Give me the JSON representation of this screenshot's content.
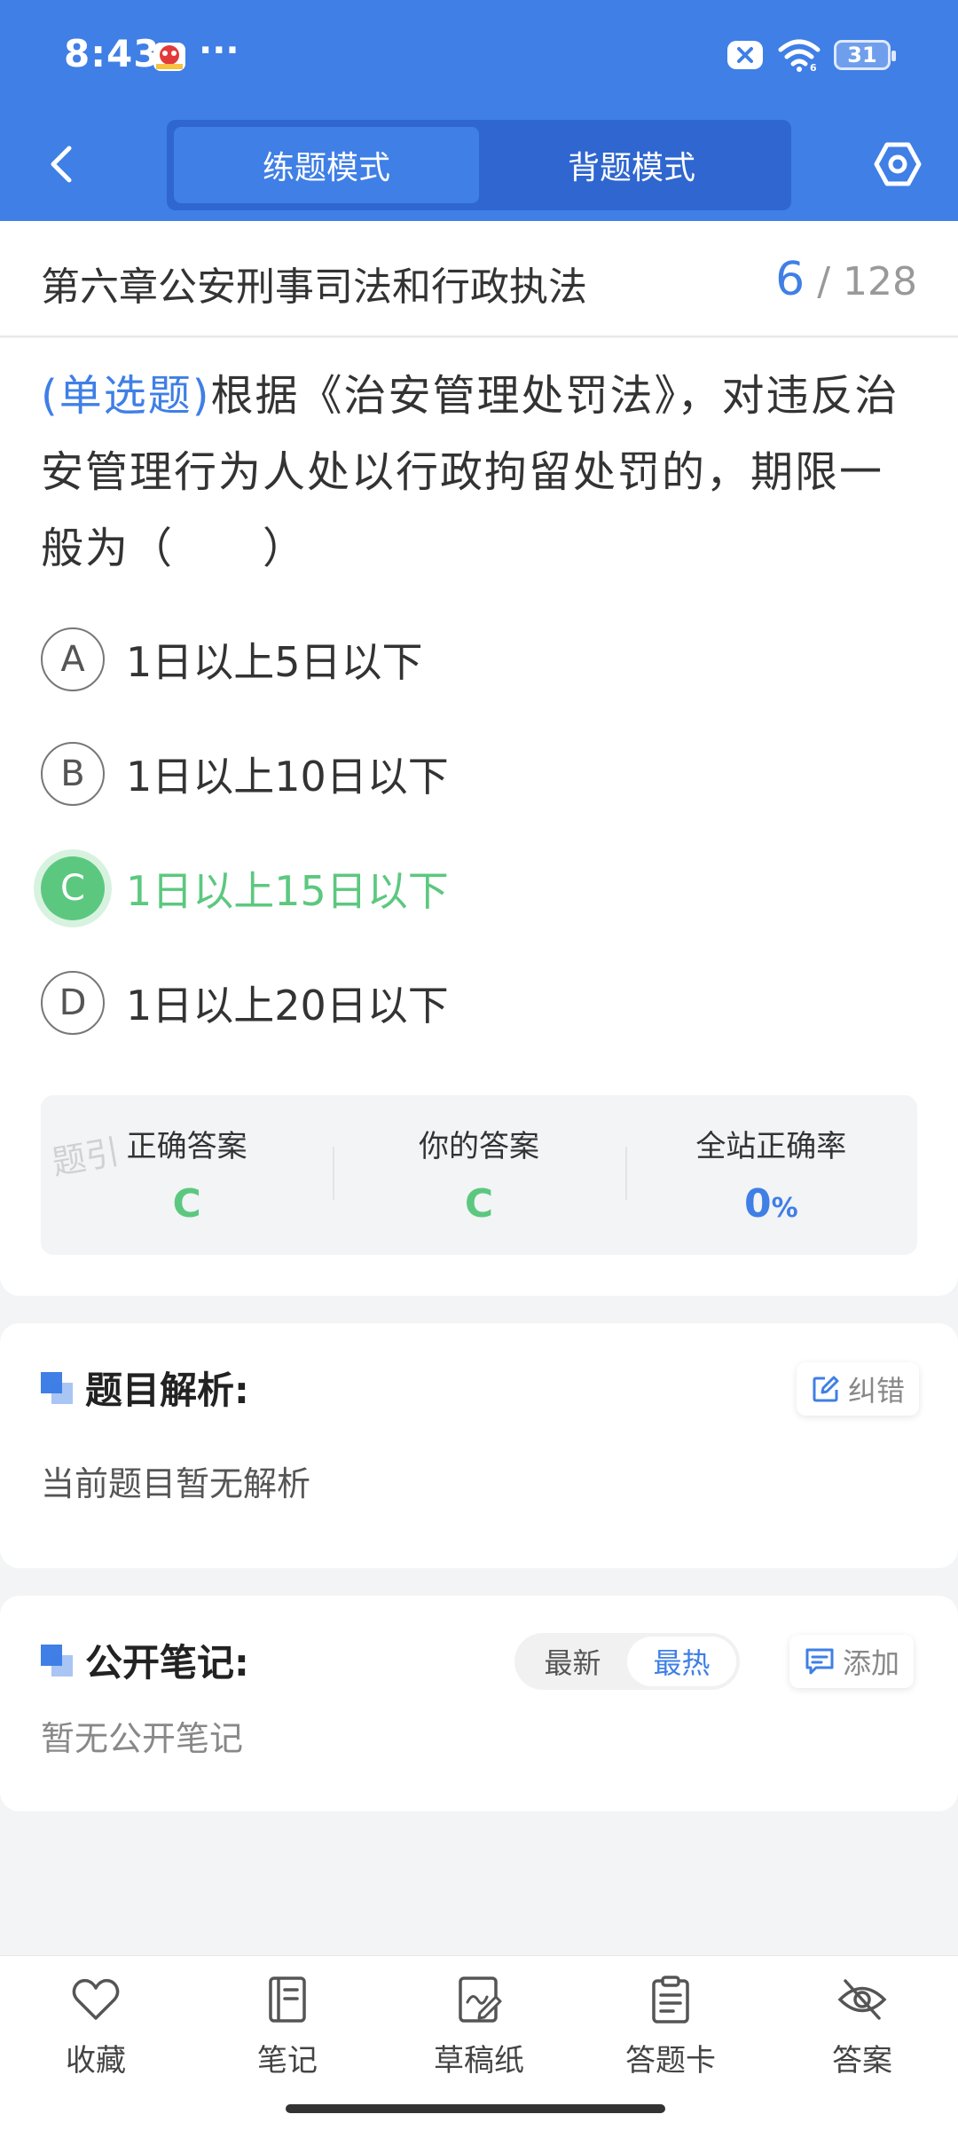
{
  "status_bar": {
    "time": "8:43",
    "dots": "···",
    "battery": "31"
  },
  "nav": {
    "tabs": [
      {
        "label": "练题模式",
        "active": true
      },
      {
        "label": "背题模式",
        "active": false
      }
    ]
  },
  "chapter": {
    "title": "第六章公安刑事司法和行政执法",
    "current": "6",
    "separator": "/",
    "total": "128"
  },
  "question": {
    "type_label": "(单选题)",
    "text": "根据《治安管理处罚法》，对违反治安管理行为人处以行政拘留处罚的，期限一般为（　　）",
    "options": [
      {
        "letter": "A",
        "text": "1日以上5日以下"
      },
      {
        "letter": "B",
        "text": "1日以上10日以下"
      },
      {
        "letter": "C",
        "text": "1日以上15日以下"
      },
      {
        "letter": "D",
        "text": "1日以上20日以下"
      }
    ],
    "selected": "C"
  },
  "answer_summary": {
    "correct_label": "正确答案",
    "correct_value": "C",
    "yours_label": "你的答案",
    "yours_value": "C",
    "rate_label": "全站正确率",
    "rate_value": "0",
    "rate_unit": "%",
    "watermark": "题引"
  },
  "analysis": {
    "title": "题目解析:",
    "report_button": "纠错",
    "text": "当前题目暂无解析"
  },
  "notes": {
    "title": "公开笔记:",
    "sort_newest": "最新",
    "sort_hottest": "最热",
    "add_button": "添加",
    "empty_text": "暂无公开笔记"
  },
  "bottom_bar": {
    "items": [
      {
        "label": "收藏",
        "icon": "heart-icon"
      },
      {
        "label": "笔记",
        "icon": "notebook-icon"
      },
      {
        "label": "草稿纸",
        "icon": "draft-paper-icon"
      },
      {
        "label": "答题卡",
        "icon": "answer-card-icon"
      },
      {
        "label": "答案",
        "icon": "eye-off-icon"
      }
    ]
  },
  "colors": {
    "primary": "#3f7fe6",
    "correct": "#5cc87f"
  }
}
